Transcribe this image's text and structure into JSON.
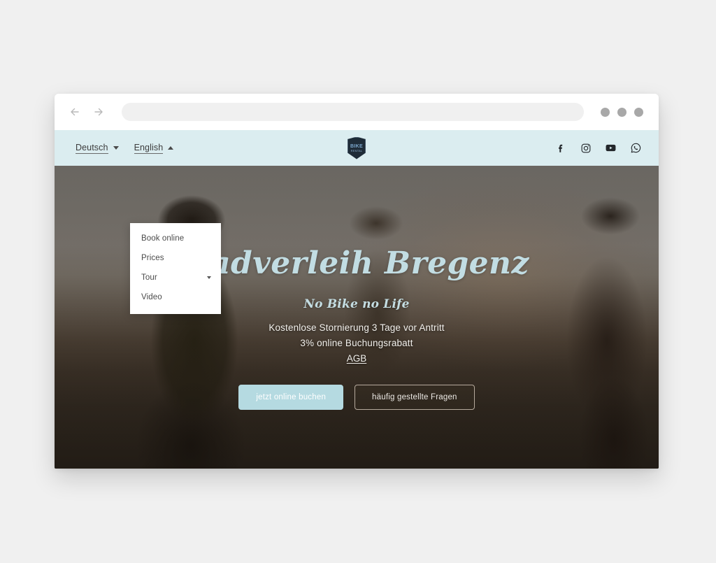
{
  "browser": {
    "back_icon": "arrow-left-icon",
    "forward_icon": "arrow-right-icon",
    "url_value": "",
    "url_placeholder": "",
    "window_dots": 3
  },
  "site_header": {
    "background_color": "#dbedf0",
    "languages": [
      {
        "label": "Deutsch",
        "state": "collapsed",
        "caret": "caret-down"
      },
      {
        "label": "English",
        "state": "expanded",
        "caret": "caret-up"
      }
    ],
    "logo": {
      "line1": "BIKE",
      "line2": "RENTAL",
      "name": "bike-rental-logo"
    },
    "social": [
      {
        "name": "facebook-icon",
        "label": "Facebook"
      },
      {
        "name": "instagram-icon",
        "label": "Instagram"
      },
      {
        "name": "youtube-icon",
        "label": "YouTube"
      },
      {
        "name": "whatsapp-icon",
        "label": "WhatsApp"
      }
    ]
  },
  "dropdown": {
    "open_for": "English",
    "items": [
      {
        "label": "Book online",
        "has_submenu": false
      },
      {
        "label": "Prices",
        "has_submenu": false
      },
      {
        "label": "Tour",
        "has_submenu": true
      },
      {
        "label": "Video",
        "has_submenu": false
      }
    ]
  },
  "hero": {
    "title": "Radverleih Bregenz",
    "subtitle": "No Bike no Life",
    "line1": "Kostenlose Stornierung 3 Tage vor Antritt",
    "line2": "3% online Buchungsrabatt",
    "link": "AGB",
    "title_color": "#c2dde3",
    "buttons": {
      "primary": "jetzt online buchen",
      "secondary": "häufig gestellte Fragen",
      "primary_color": "#b5dae1"
    }
  }
}
